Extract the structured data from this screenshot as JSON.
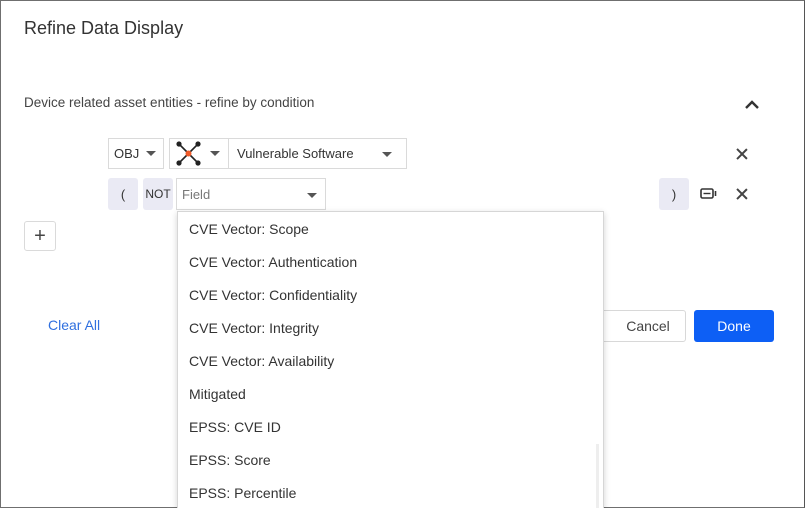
{
  "dialog": {
    "title": "Refine Data Display"
  },
  "section": {
    "title": "Device related asset entities - refine by condition"
  },
  "condition_row": {
    "obj_label": "OBJ",
    "entity_label": "Vulnerable Software"
  },
  "field_row": {
    "open_paren": "(",
    "not_label": "NOT",
    "field_placeholder": "Field",
    "close_paren": ")"
  },
  "add_label": "+",
  "footer": {
    "clear_all": "Clear All",
    "cancel": "Cancel",
    "done": "Done"
  },
  "dropdown": {
    "items": [
      "CVE Vector: Scope",
      "CVE Vector: Authentication",
      "CVE Vector: Confidentiality",
      "CVE Vector: Integrity",
      "CVE Vector: Availability",
      "Mitigated",
      "EPSS: CVE ID",
      "EPSS: Score",
      "EPSS: Percentile"
    ]
  },
  "colors": {
    "primary": "#0d5ff5",
    "link": "#2f6fdf",
    "paren_bg": "#eaeaf4",
    "icon_accent": "#f05a28"
  },
  "icons": {
    "collapse": "chevron-up-icon",
    "entity_type": "network-node-icon",
    "remove": "close-icon",
    "condition_toggle": "condition-settings-icon"
  }
}
